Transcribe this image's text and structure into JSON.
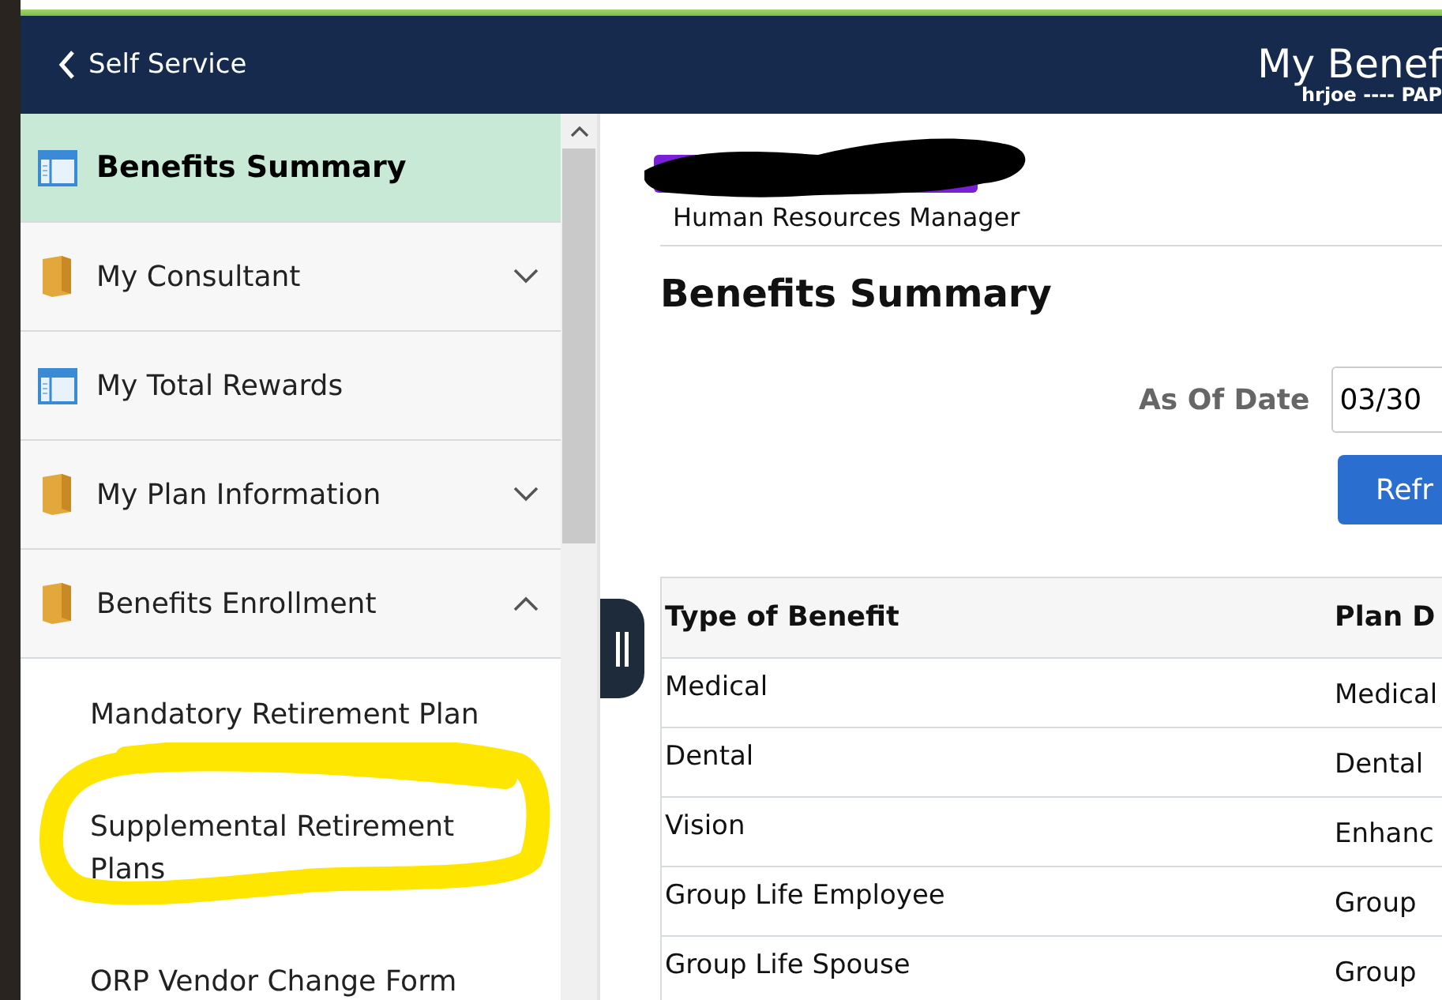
{
  "header": {
    "back_label": "Self Service",
    "title": "My Benef",
    "subtitle": "hrjoe ---- PAP"
  },
  "sidebar": {
    "items": [
      {
        "label": "Benefits Summary",
        "kind": "page",
        "selected": true
      },
      {
        "label": "My Consultant",
        "kind": "folder",
        "selected": false,
        "expanded": false
      },
      {
        "label": "My Total Rewards",
        "kind": "page",
        "selected": false
      },
      {
        "label": "My Plan Information",
        "kind": "folder",
        "selected": false,
        "expanded": false
      },
      {
        "label": "Benefits Enrollment",
        "kind": "folder",
        "selected": false,
        "expanded": true,
        "children": [
          {
            "label": "Mandatory Retirement Plan",
            "selected": false
          },
          {
            "label": "Supplemental Retirement Plans",
            "selected": false
          },
          {
            "label": "ORP Vendor Change Form",
            "selected": false
          }
        ]
      }
    ]
  },
  "profile": {
    "job_title": "Human Resources Manager"
  },
  "page_title": "Benefits Summary",
  "as_of_date": {
    "label": "As Of Date",
    "value": "03/30"
  },
  "refresh_button": "Refr",
  "table": {
    "columns": [
      "Type of Benefit",
      "Plan D"
    ],
    "rows": [
      [
        "Medical",
        "Medical"
      ],
      [
        "Dental",
        "Dental"
      ],
      [
        "Vision",
        "Enhanc"
      ],
      [
        "Group Life Employee",
        "Group"
      ],
      [
        "Group Life Spouse",
        "Group"
      ]
    ]
  }
}
